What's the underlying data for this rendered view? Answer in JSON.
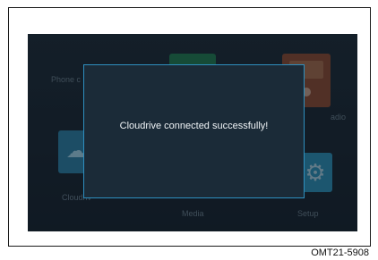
{
  "home_menu": {
    "tiles": [
      {
        "label": "Phone c",
        "icon": "phone-icon"
      },
      {
        "label": "",
        "icon": "green-app-icon"
      },
      {
        "label": "adio",
        "icon": "radio-icon"
      },
      {
        "label": "Cloudriv",
        "icon": "cloud-icon"
      },
      {
        "label": "Media",
        "icon": "media-icon"
      },
      {
        "label": "Setup",
        "icon": "gear-icon"
      }
    ]
  },
  "dialog": {
    "message": "Cloudrive connected successfully!"
  },
  "figure_code": "OMT21-5908",
  "colors": {
    "screen_bg": "#182530",
    "dialog_bg": "#1b2b38",
    "dialog_border": "#2e8fbf",
    "text": "#f0f4f7"
  }
}
